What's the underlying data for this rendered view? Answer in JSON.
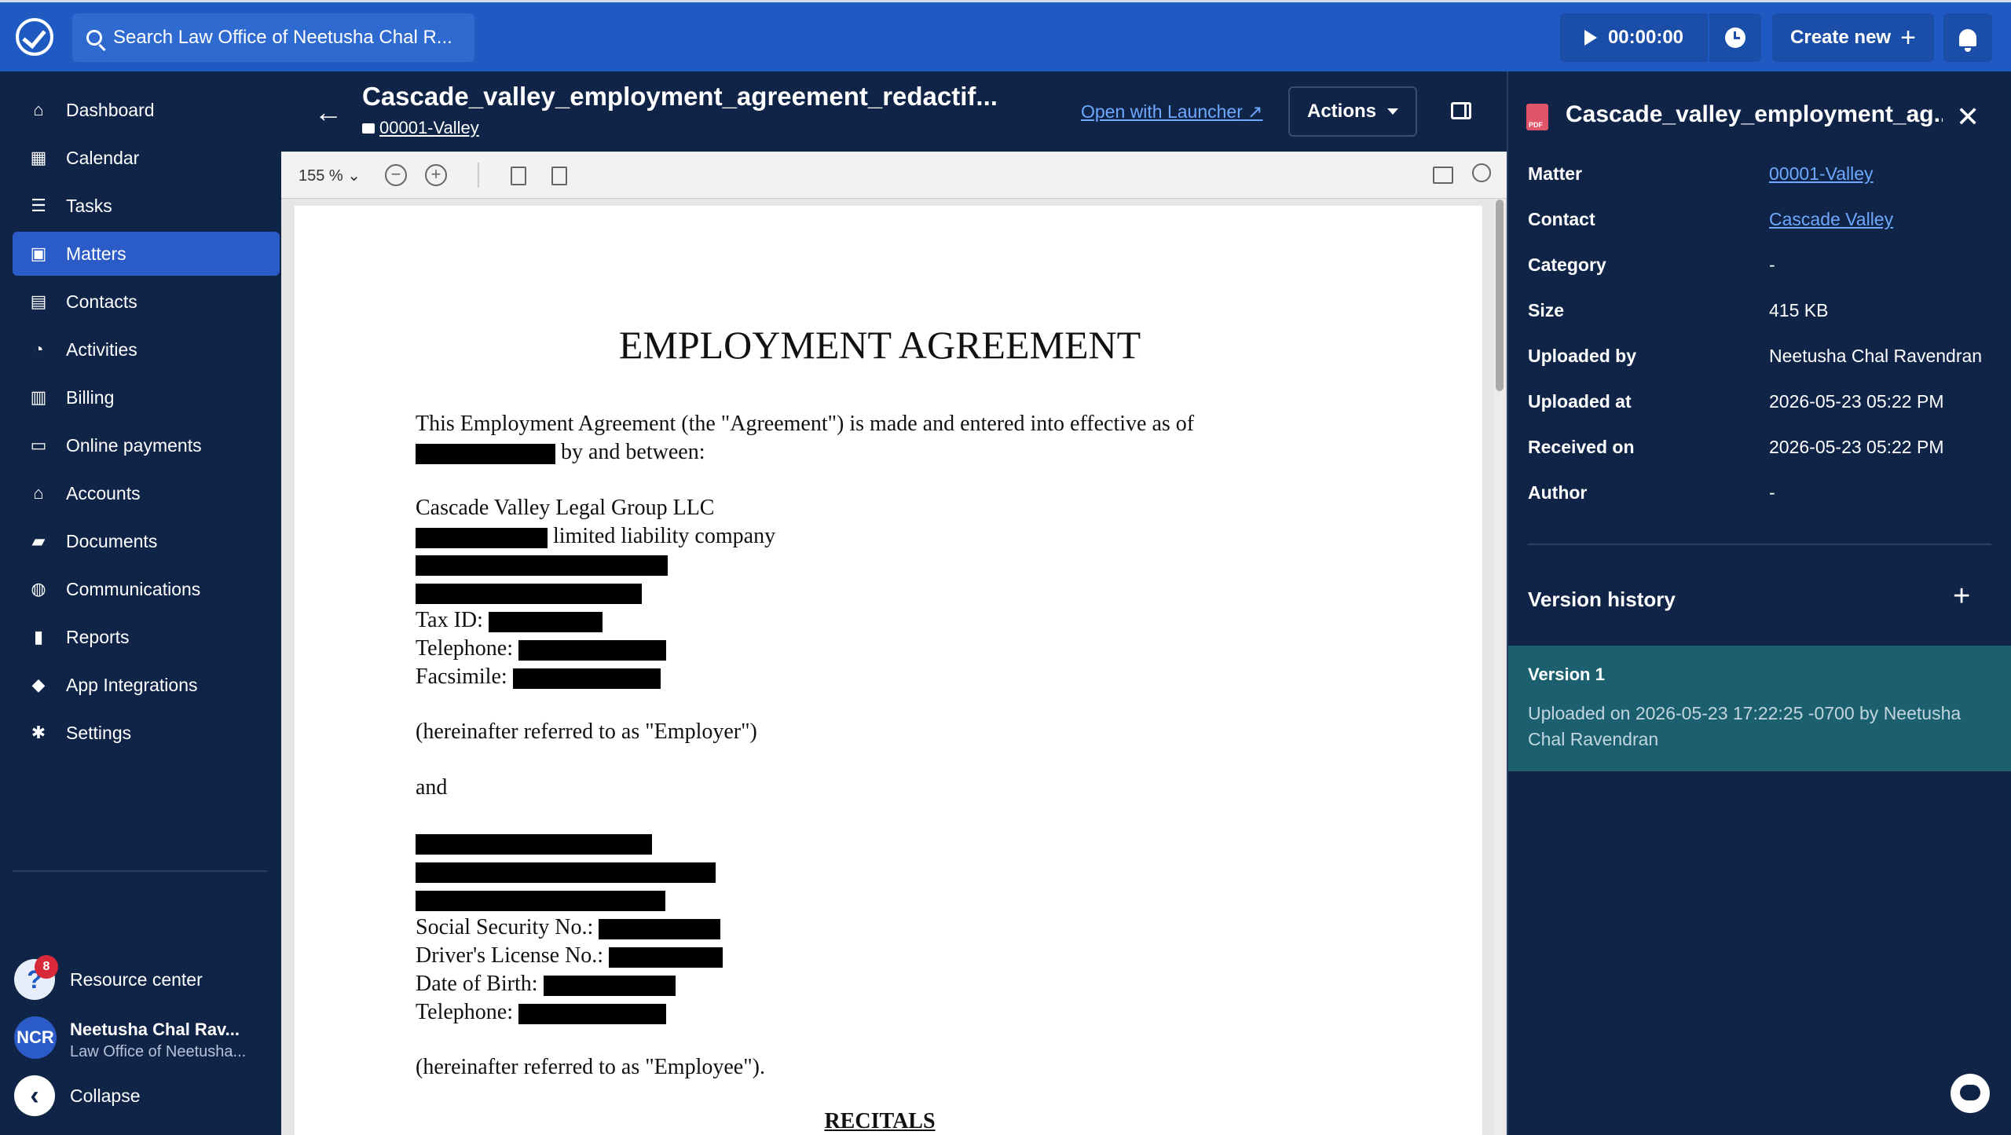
{
  "app": {
    "search_placeholder": "Search Law Office of Neetusha Chal R...",
    "timer": "00:00:00",
    "create_new": "Create new"
  },
  "sidebar": {
    "items": [
      {
        "label": "Dashboard",
        "icon": "home-icon"
      },
      {
        "label": "Calendar",
        "icon": "calendar-icon"
      },
      {
        "label": "Tasks",
        "icon": "list-icon"
      },
      {
        "label": "Matters",
        "icon": "briefcase-icon",
        "active": true
      },
      {
        "label": "Contacts",
        "icon": "contact-card-icon"
      },
      {
        "label": "Activities",
        "icon": "clock-icon"
      },
      {
        "label": "Billing",
        "icon": "receipt-icon"
      },
      {
        "label": "Online payments",
        "icon": "credit-card-icon"
      },
      {
        "label": "Accounts",
        "icon": "bank-icon"
      },
      {
        "label": "Documents",
        "icon": "folder-icon"
      },
      {
        "label": "Communications",
        "icon": "chat-bubbles-icon"
      },
      {
        "label": "Reports",
        "icon": "bar-chart-icon"
      },
      {
        "label": "App Integrations",
        "icon": "shapes-icon"
      },
      {
        "label": "Settings",
        "icon": "gear-icon"
      }
    ],
    "resource_center": {
      "label": "Resource center",
      "badge": "8"
    },
    "user": {
      "initials": "NCR",
      "name": "Neetusha Chal Rav...",
      "firm": "Law Office of Neetusha..."
    },
    "collapse": "Collapse"
  },
  "document": {
    "title": "Cascade_valley_employment_agreement_redactif...",
    "matter": "00001-Valley",
    "open_with_launcher": "Open with Launcher",
    "actions": "Actions",
    "zoom": "155 %",
    "heading": "EMPLOYMENT AGREEMENT",
    "intro_line1": "This Employment Agreement (the \"Agreement\") is made and entered into effective as of",
    "intro_line2": "by and between:",
    "employer_name": "Cascade Valley Legal Group LLC",
    "employer_type": "limited liability company",
    "tax_id": "Tax ID:",
    "telephone": "Telephone:",
    "facsimile": "Facsimile:",
    "employer_ref": "(hereinafter referred to as \"Employer\")",
    "and": "and",
    "ssn": "Social Security No.:",
    "drivers_license": "Driver's License No.:",
    "dob": "Date of Birth:",
    "telephone2": "Telephone:",
    "employee_ref": "(hereinafter referred to as \"Employee\").",
    "recitals": "RECITALS"
  },
  "details": {
    "title": "Cascade_valley_employment_ag...",
    "rows": [
      {
        "label": "Matter",
        "value": "00001-Valley",
        "link": true
      },
      {
        "label": "Contact",
        "value": "Cascade Valley",
        "link": true
      },
      {
        "label": "Category",
        "value": "-"
      },
      {
        "label": "Size",
        "value": "415 KB"
      },
      {
        "label": "Uploaded by",
        "value": "Neetusha Chal Ravendran"
      },
      {
        "label": "Uploaded at",
        "value": "2026-05-23 05:22 PM"
      },
      {
        "label": "Received on",
        "value": "2026-05-23 05:22 PM"
      },
      {
        "label": "Author",
        "value": "-"
      }
    ],
    "version_history": "Version history",
    "version": {
      "name": "Version 1",
      "desc": "Uploaded on 2026-05-23 17:22:25 -0700 by Neetusha Chal Ravendran"
    }
  }
}
